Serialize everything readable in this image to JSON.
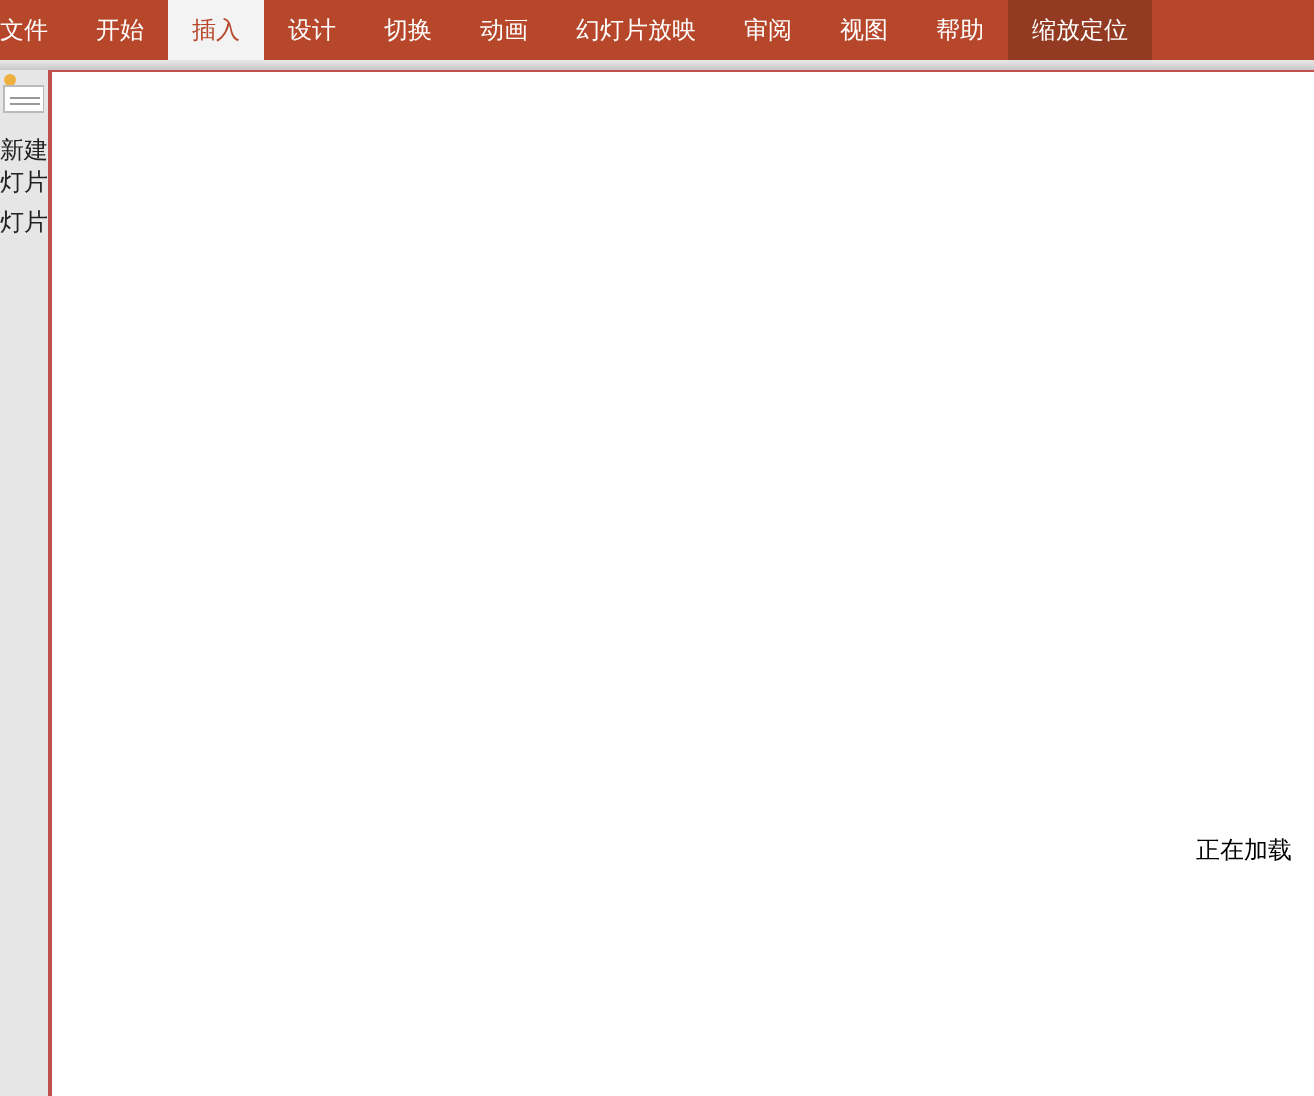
{
  "tabs": [
    {
      "label": "文件",
      "selected": false,
      "kind": "normal"
    },
    {
      "label": "开始",
      "selected": false,
      "kind": "normal"
    },
    {
      "label": "插入",
      "selected": true,
      "kind": "normal"
    },
    {
      "label": "设计",
      "selected": false,
      "kind": "normal"
    },
    {
      "label": "切换",
      "selected": false,
      "kind": "normal"
    },
    {
      "label": "动画",
      "selected": false,
      "kind": "normal"
    },
    {
      "label": "幻灯片放映",
      "selected": false,
      "kind": "normal"
    },
    {
      "label": "审阅",
      "selected": false,
      "kind": "normal"
    },
    {
      "label": "视图",
      "selected": false,
      "kind": "normal"
    },
    {
      "label": "帮助",
      "selected": false,
      "kind": "normal"
    },
    {
      "label": "缩放定位",
      "selected": false,
      "kind": "contextual"
    }
  ],
  "side_panel": {
    "items": [
      "新建",
      "灯片",
      "灯片"
    ]
  },
  "dialog": {
    "status": "正在加载"
  }
}
